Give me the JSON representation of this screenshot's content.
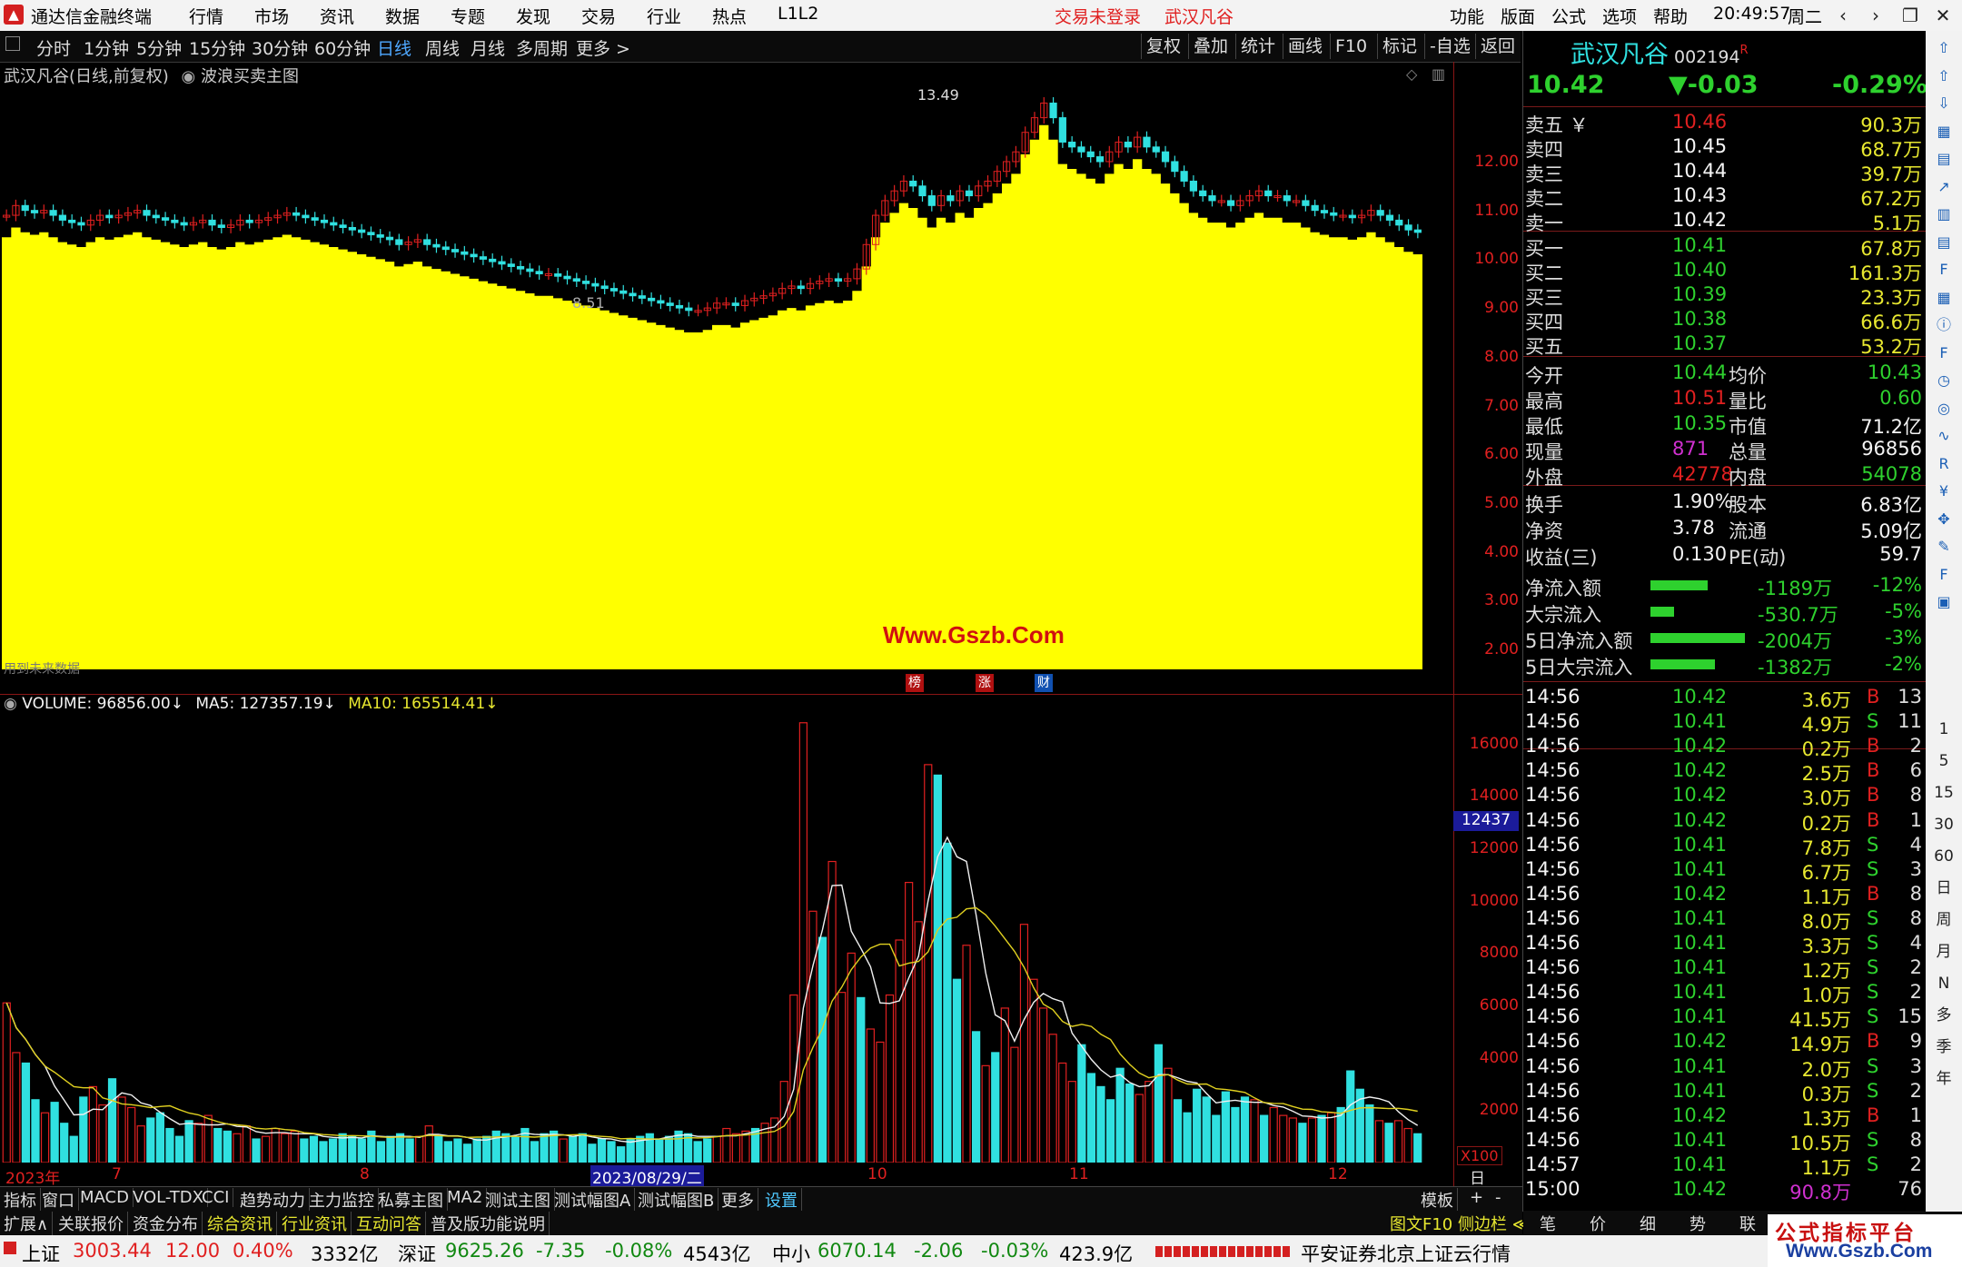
{
  "app": {
    "title": "通达信金融终端",
    "menu": [
      "行情",
      "市场",
      "资讯",
      "数据",
      "专题",
      "发现",
      "交易",
      "行业",
      "热点",
      "L1L2"
    ],
    "login_status": "交易未登录",
    "stock_name": "武汉凡谷",
    "right_menu": [
      "功能",
      "版面",
      "公式",
      "选项",
      "帮助"
    ],
    "clock": "20:49:57",
    "weekday": "周二",
    "win_controls": [
      "back-icon",
      "forward-icon",
      "restore-icon",
      "close-icon"
    ]
  },
  "toolbar": {
    "periods": [
      "分时",
      "1分钟",
      "5分钟",
      "15分钟",
      "30分钟",
      "60分钟",
      "日线",
      "周线",
      "月线",
      "多周期",
      "更多 >"
    ],
    "active": "日线",
    "right": [
      "复权",
      "叠加",
      "统计",
      "画线",
      "F10",
      "标记",
      "-自选",
      "返回"
    ]
  },
  "chart": {
    "header": "武汉凡谷(日线,前复权)",
    "indicator": "波浪买卖主图",
    "high_marker": "13.49",
    "low_marker": "8.51",
    "watermark": "Www.Gszb.Com",
    "yticks": [
      "12.00",
      "11.00",
      "10.00",
      "9.00",
      "8.00",
      "7.00",
      "6.00",
      "5.00",
      "4.00",
      "3.00",
      "2.00"
    ],
    "badges": [
      "榜",
      "涨",
      "财"
    ],
    "small_label": "用到未来数据"
  },
  "volume": {
    "label": "VOLUME: 96856.00",
    "ma5": "MA5: 127357.19",
    "ma10": "MA10: 165514.41",
    "yticks": [
      "16000",
      "14000",
      "12000",
      "10000",
      "8000",
      "6000",
      "4000",
      "2000"
    ],
    "cursor_value": "12437",
    "unit": "X100"
  },
  "date_axis": {
    "year": "2023年",
    "m7": "7",
    "m8": "8",
    "selected": "2023/08/29/二",
    "m10": "10",
    "m11": "11",
    "m12": "12",
    "label": "日线"
  },
  "tabs1": [
    "指标",
    "窗口",
    "MACD",
    "VOL-TDX",
    "CCI",
    "趋势动力",
    "主力监控",
    "私募主图",
    "MA2",
    "测试主图",
    "测试幅图A",
    "测试幅图B",
    "更多",
    "设置"
  ],
  "tabs1_right": [
    "模板",
    "+",
    "-"
  ],
  "tabs2": [
    "扩展∧",
    "关联报价",
    "资金分布",
    "综合资讯",
    "行业资讯",
    "互动问答",
    "普及版功能说明"
  ],
  "tabs2_right": "图文F10 侧边栏 ≪",
  "status": {
    "sh_name": "上证",
    "sh_val": "3003.44",
    "sh_chg": "12.00",
    "sh_pct": "0.40%",
    "sh_amt": "3332亿",
    "sz_name": "深证",
    "sz_val": "9625.26",
    "sz_chg": "-7.35",
    "sz_pct": "-0.08%",
    "sz_amt": "4543亿",
    "zx_name": "中小",
    "zx_val": "6070.14",
    "zx_chg": "-2.06",
    "zx_pct": "-0.03%",
    "zx_amt": "423.9亿",
    "broker": "平安证券北京上证云行情"
  },
  "quote": {
    "name": "武汉凡谷",
    "code": "002194",
    "flag": "R",
    "price": "10.42",
    "change": "▼-0.03",
    "pct": "-0.29%",
    "asks": [
      {
        "label": "卖五 ￥",
        "price": "10.46",
        "vol": "90.3万"
      },
      {
        "label": "卖四",
        "price": "10.45",
        "vol": "68.7万"
      },
      {
        "label": "卖三",
        "price": "10.44",
        "vol": "39.7万"
      },
      {
        "label": "卖二",
        "price": "10.43",
        "vol": "67.2万"
      },
      {
        "label": "卖一",
        "price": "10.42",
        "vol": "5.1万"
      }
    ],
    "bids": [
      {
        "label": "买一",
        "price": "10.41",
        "vol": "67.8万"
      },
      {
        "label": "买二",
        "price": "10.40",
        "vol": "161.3万"
      },
      {
        "label": "买三",
        "price": "10.39",
        "vol": "23.3万"
      },
      {
        "label": "买四",
        "price": "10.38",
        "vol": "66.6万"
      },
      {
        "label": "买五",
        "price": "10.37",
        "vol": "53.2万"
      }
    ],
    "stats": [
      [
        "今开",
        "10.44",
        "均价",
        "10.43"
      ],
      [
        "最高",
        "10.51",
        "量比",
        "0.60"
      ],
      [
        "最低",
        "10.35",
        "市值",
        "71.2亿"
      ],
      [
        "现量",
        "871",
        "总量",
        "96856"
      ],
      [
        "外盘",
        "42778",
        "内盘",
        "54078"
      ]
    ],
    "stats2": [
      [
        "换手",
        "1.90%",
        "股本",
        "6.83亿"
      ],
      [
        "净资",
        "3.78",
        "流通",
        "5.09亿"
      ],
      [
        "收益(三)",
        "0.130",
        "PE(动)",
        "59.7"
      ]
    ],
    "flows": [
      {
        "label": "净流入额",
        "bar": 0.38,
        "val": "-1189万",
        "pct": "-12%"
      },
      {
        "label": "大宗流入",
        "bar": 0.16,
        "val": "-530.7万",
        "pct": "-5%"
      },
      {
        "label": "5日净流入额",
        "bar": 0.63,
        "val": "-2004万",
        "pct": "-3%"
      },
      {
        "label": "5日大宗流入",
        "bar": 0.43,
        "val": "-1382万",
        "pct": "-2%"
      }
    ],
    "ticks": [
      [
        "14:56",
        "10.42",
        "3.6万",
        "B",
        "13"
      ],
      [
        "14:56",
        "10.41",
        "4.9万",
        "S",
        "11"
      ],
      [
        "14:56",
        "10.42",
        "0.2万",
        "B",
        "2"
      ],
      [
        "14:56",
        "10.42",
        "2.5万",
        "B",
        "6"
      ],
      [
        "14:56",
        "10.42",
        "3.0万",
        "B",
        "8"
      ],
      [
        "14:56",
        "10.42",
        "0.2万",
        "B",
        "1"
      ],
      [
        "14:56",
        "10.41",
        "7.8万",
        "S",
        "4"
      ],
      [
        "14:56",
        "10.41",
        "6.7万",
        "S",
        "3"
      ],
      [
        "14:56",
        "10.42",
        "1.1万",
        "B",
        "8"
      ],
      [
        "14:56",
        "10.41",
        "8.0万",
        "S",
        "8"
      ],
      [
        "14:56",
        "10.41",
        "3.3万",
        "S",
        "4"
      ],
      [
        "14:56",
        "10.41",
        "1.2万",
        "S",
        "2"
      ],
      [
        "14:56",
        "10.41",
        "1.0万",
        "S",
        "2"
      ],
      [
        "14:56",
        "10.41",
        "41.5万",
        "S",
        "15"
      ],
      [
        "14:56",
        "10.42",
        "14.9万",
        "B",
        "9"
      ],
      [
        "14:56",
        "10.41",
        "2.0万",
        "S",
        "3"
      ],
      [
        "14:56",
        "10.41",
        "0.3万",
        "S",
        "2"
      ],
      [
        "14:56",
        "10.42",
        "1.3万",
        "B",
        "1"
      ],
      [
        "14:56",
        "10.41",
        "10.5万",
        "S",
        "8"
      ],
      [
        "14:57",
        "10.41",
        "1.1万",
        "S",
        "2"
      ],
      [
        "15:00",
        "10.42",
        "90.8万",
        "",
        "76"
      ]
    ],
    "bottom_tabs": [
      "笔",
      "价",
      "细",
      "势",
      "联"
    ]
  },
  "side_icons": [
    "arrow-up-icon",
    "arrow-up2-icon",
    "arrow-down-icon",
    "chart-icon",
    "grid-icon",
    "line-icon",
    "bars-icon",
    "list-icon",
    "f10-icon",
    "table-icon",
    "info-icon",
    "f2-icon",
    "clock-icon",
    "circle-icon",
    "wave-icon",
    "rsi-icon",
    "money-icon",
    "move-icon",
    "pen-icon",
    "fs-icon",
    "save-icon"
  ],
  "side_labels": [
    "1",
    "5",
    "15",
    "30",
    "60",
    "日",
    "周",
    "月",
    "N",
    "多",
    "季",
    "年"
  ],
  "logo_text": "公式指标平台",
  "logo_url": "Www.Gszb.Com",
  "colors": {
    "up": "#e02020",
    "down": "#30e0e0",
    "area": "#ffff00",
    "ma5": "#f0f0f0",
    "ma10": "#e0d020"
  },
  "chart_data": {
    "type": "bar",
    "title": "VOLUME",
    "ylim": [
      0,
      17000
    ],
    "values": [
      6100,
      4200,
      3800,
      2400,
      1900,
      2300,
      1500,
      1000,
      2500,
      2900,
      2200,
      3200,
      2500,
      2100,
      1400,
      1700,
      1900,
      1300,
      1000,
      1600,
      1500,
      1800,
      1300,
      1200,
      1100,
      1400,
      900,
      1000,
      1300,
      1100,
      1200,
      900,
      1000,
      800,
      900,
      1100,
      1000,
      900,
      1200,
      800,
      1000,
      1100,
      900,
      1000,
      1400,
      1000,
      800,
      900,
      700,
      900,
      1000,
      1200,
      1100,
      1000,
      1300,
      800,
      1100,
      1200,
      900,
      1000,
      1100,
      700,
      900,
      800,
      600,
      900,
      1000,
      1100,
      900,
      1000,
      1200,
      1100,
      800,
      900,
      1000,
      1300,
      1100,
      1200,
      1300,
      1500,
      1700,
      3100,
      6400,
      16800,
      9600,
      8600,
      11500,
      6500,
      8000,
      6300,
      5100,
      4600,
      6400,
      8500,
      10700,
      9200,
      15200,
      14800,
      12200,
      7000,
      8300,
      5000,
      3700,
      4200,
      5900,
      4400,
      9100,
      7000,
      5900,
      4900,
      3800,
      3100,
      4500,
      3400,
      2900,
      2400,
      3600,
      3000,
      2600,
      3100,
      4500,
      3600,
      2400,
      1900,
      2800,
      2500,
      1800,
      2700,
      2100,
      2500,
      2400,
      1800,
      2100,
      1800,
      1700,
      1500,
      1700,
      1800,
      1900,
      2100,
      3500,
      2800,
      2200,
      1600,
      1500,
      1600,
      1300,
      1100
    ],
    "x_labels": [
      "2023年",
      "7",
      "8",
      "2023/08/29/二",
      "10",
      "11",
      "12"
    ]
  },
  "price_data": {
    "closes": [
      10.9,
      11.1,
      11.0,
      10.95,
      11.0,
      10.9,
      10.8,
      10.75,
      10.7,
      10.8,
      10.9,
      10.85,
      10.9,
      10.95,
      11.0,
      10.9,
      10.85,
      10.8,
      10.75,
      10.7,
      10.75,
      10.8,
      10.7,
      10.65,
      10.7,
      10.8,
      10.75,
      10.8,
      10.85,
      10.9,
      10.95,
      10.9,
      10.85,
      10.8,
      10.75,
      10.7,
      10.65,
      10.6,
      10.55,
      10.5,
      10.45,
      10.4,
      10.3,
      10.35,
      10.4,
      10.3,
      10.25,
      10.2,
      10.15,
      10.1,
      10.05,
      10.0,
      9.95,
      9.9,
      9.85,
      9.8,
      9.75,
      9.7,
      9.7,
      9.65,
      9.6,
      9.55,
      9.5,
      9.45,
      9.4,
      9.35,
      9.3,
      9.25,
      9.2,
      9.15,
      9.1,
      9.05,
      9.0,
      8.95,
      8.95,
      9.0,
      9.1,
      9.1,
      9.05,
      9.15,
      9.2,
      9.25,
      9.3,
      9.4,
      9.45,
      9.4,
      9.5,
      9.55,
      9.6,
      9.55,
      9.6,
      9.8,
      10.3,
      10.9,
      11.2,
      11.4,
      11.6,
      11.5,
      11.3,
      11.1,
      11.3,
      11.2,
      11.4,
      11.3,
      11.5,
      11.6,
      11.8,
      12.0,
      12.2,
      12.6,
      12.9,
      13.2,
      12.9,
      12.4,
      12.3,
      12.2,
      12.1,
      12.0,
      12.2,
      12.4,
      12.3,
      12.5,
      12.3,
      12.2,
      12.0,
      11.8,
      11.6,
      11.4,
      11.3,
      11.2,
      11.2,
      11.1,
      11.2,
      11.3,
      11.4,
      11.3,
      11.3,
      11.2,
      11.2,
      11.1,
      11.0,
      10.95,
      10.9,
      10.9,
      10.85,
      10.9,
      11.0,
      10.9,
      10.8,
      10.7,
      10.6,
      10.55
    ]
  }
}
